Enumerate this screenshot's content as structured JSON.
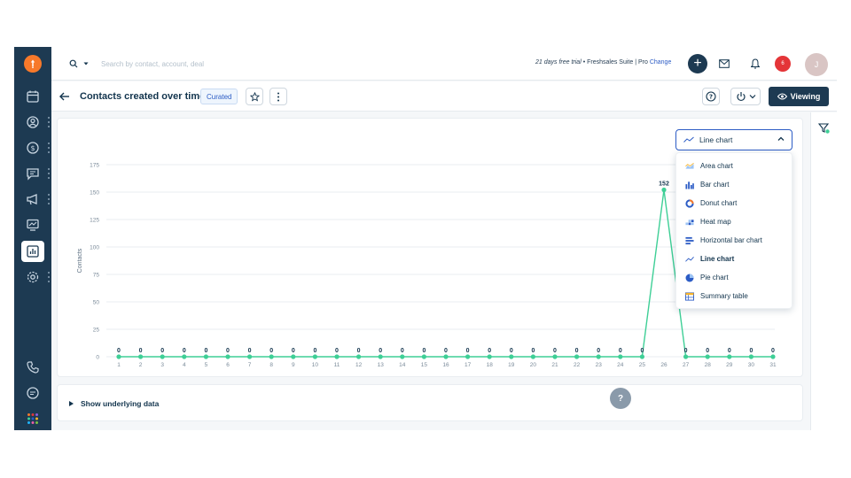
{
  "search": {
    "placeholder": "Search by contact, account, deal"
  },
  "header": {
    "trial_text": "21 days free trial",
    "product_text": "Freshsales Suite | Pro",
    "change_link": "Change",
    "notification_count": "6",
    "avatar_initial": "J"
  },
  "report": {
    "title": "Contacts created over time",
    "badge": "Curated",
    "viewing_label": "Viewing"
  },
  "chart_type_select": {
    "selected": "Line chart",
    "options": [
      {
        "label": "Area chart",
        "icon": "area-chart-icon"
      },
      {
        "label": "Bar chart",
        "icon": "bar-chart-icon"
      },
      {
        "label": "Donut chart",
        "icon": "donut-chart-icon"
      },
      {
        "label": "Heat map",
        "icon": "heat-map-icon"
      },
      {
        "label": "Horizontal bar chart",
        "icon": "horizontal-bar-chart-icon"
      },
      {
        "label": "Line chart",
        "icon": "line-chart-icon"
      },
      {
        "label": "Pie chart",
        "icon": "pie-chart-icon"
      },
      {
        "label": "Summary table",
        "icon": "summary-table-icon"
      }
    ]
  },
  "underlying": {
    "label": "Show underlying data"
  },
  "help_fab": "?",
  "colors": {
    "series": "#3ecf96",
    "primary": "#1d3a52",
    "accent": "#2c5cc5",
    "badge": "#e43538"
  },
  "chart_data": {
    "type": "line",
    "xlabel": "",
    "ylabel": "Contacts",
    "ylim": [
      0,
      175
    ],
    "yticks": [
      0,
      25,
      50,
      75,
      100,
      125,
      150,
      175
    ],
    "x": [
      "1",
      "2",
      "3",
      "4",
      "5",
      "6",
      "7",
      "8",
      "9",
      "10",
      "11",
      "12",
      "13",
      "14",
      "15",
      "16",
      "17",
      "18",
      "19",
      "20",
      "21",
      "22",
      "23",
      "24",
      "25",
      "26",
      "27",
      "28",
      "29",
      "30",
      "31"
    ],
    "series": [
      {
        "values": [
          0,
          0,
          0,
          0,
          0,
          0,
          0,
          0,
          0,
          0,
          0,
          0,
          0,
          0,
          0,
          0,
          0,
          0,
          0,
          0,
          0,
          0,
          0,
          0,
          0,
          152,
          0,
          0,
          0,
          0,
          0
        ]
      }
    ],
    "grid": true,
    "data_labels": true
  }
}
